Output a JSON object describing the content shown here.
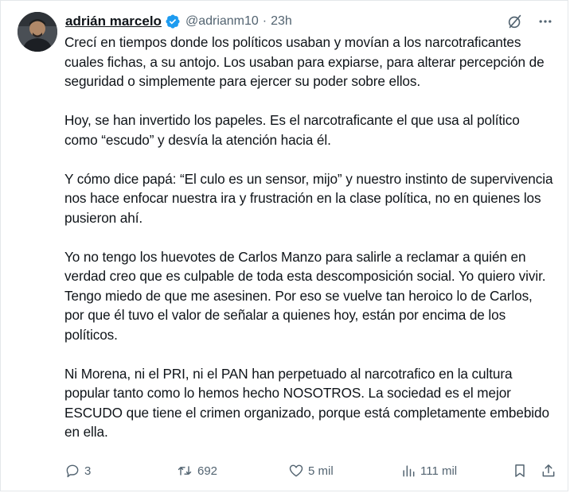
{
  "author": {
    "display_name": "adrián marcelo",
    "handle": "@adrianm10",
    "separator": "·",
    "time": "23h"
  },
  "icons": {
    "avatar": "avatar-photo",
    "verified": "verified-badge-icon",
    "grok": "grok-slash-circle-icon",
    "more": "more-dots-icon",
    "reply": "reply-bubble-icon",
    "retweet": "retweet-icon",
    "like": "heart-icon",
    "views": "views-bar-chart-icon",
    "bookmark": "bookmark-icon",
    "share": "share-upload-icon"
  },
  "colors": {
    "verified": "#1d9bf0",
    "muted": "#536471",
    "text": "#0f1419"
  },
  "tweet": {
    "paragraphs": [
      "Crecí en tiempos donde los políticos usaban y movían a los narcotraficantes cuales fichas, a su antojo. Los usaban para expiarse, para alterar percepción de seguridad o simplemente para ejercer su poder sobre ellos.",
      "Hoy, se han invertido los papeles. Es el narcotraficante el que usa al político como “escudo” y desvía la atención hacia él.",
      "Y cómo dice papá: “El culo es un sensor, mijo” y nuestro instinto de supervivencia nos hace enfocar nuestra ira y frustración en la clase política, no en quienes los pusieron ahí.",
      "Yo no tengo los huevotes de Carlos Manzo para salirle a reclamar a quién en verdad creo que es culpable de toda esta descomposición social. Yo quiero vivir. Tengo miedo de que me asesinen. Por eso se vuelve tan heroico lo de Carlos, por que él tuvo el valor de señalar a quienes hoy, están por encima de los políticos.",
      "Ni Morena, ni el PRI, ni el PAN han perpetuado al narcotrafico en la cultura popular tanto como lo hemos hecho NOSOTROS. La sociedad es el mejor ESCUDO que tiene el crimen organizado, porque está completamente embebido en ella."
    ]
  },
  "stats": {
    "replies": "3",
    "retweets": "692",
    "likes": "5 mil",
    "views": "111 mil"
  }
}
